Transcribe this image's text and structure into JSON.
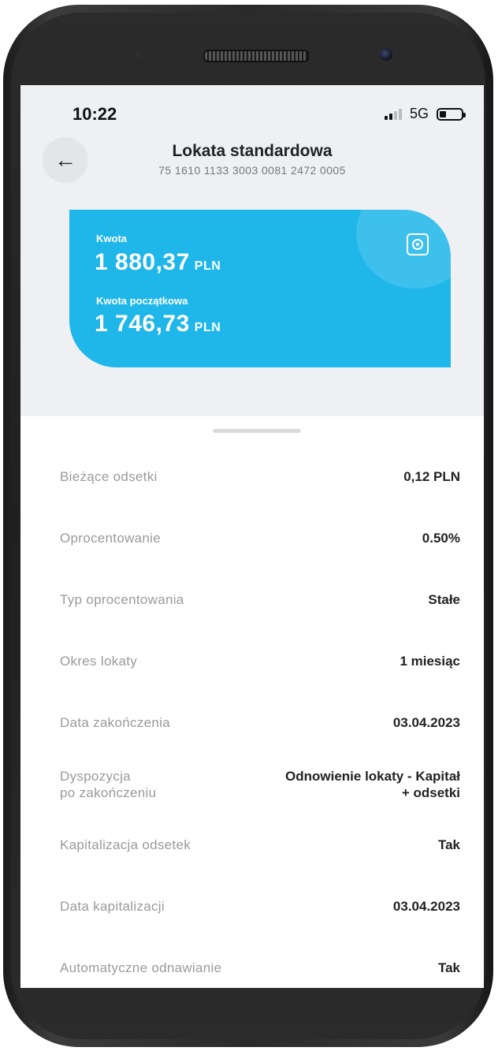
{
  "status_bar": {
    "time": "10:22",
    "network": "5G"
  },
  "header": {
    "title": "Lokata standardowa",
    "account_number": "75 1610 1133 3003 0081 2472 0005",
    "back_icon": "arrow-left-icon",
    "back_glyph": "←"
  },
  "card": {
    "accent_color": "#1fb6e9",
    "icon": "safe-icon",
    "amount_label": "Kwota",
    "amount_value": "1 880,37",
    "amount_currency": "PLN",
    "initial_label": "Kwota początkowa",
    "initial_value": "1 746,73",
    "initial_currency": "PLN"
  },
  "details": [
    {
      "label": "Bieżące odsetki",
      "value": "0,12 PLN"
    },
    {
      "label": "Oprocentowanie",
      "value": "0.50%"
    },
    {
      "label": "Typ oprocentowania",
      "value": "Stałe"
    },
    {
      "label": "Okres lokaty",
      "value": "1 miesiąc"
    },
    {
      "label": "Data zakończenia",
      "value": "03.04.2023"
    },
    {
      "label": "Dyspozycja\npo zakończeniu",
      "value": "Odnowienie lokaty - Kapitał\n+ odsetki"
    },
    {
      "label": "Kapitalizacja odsetek",
      "value": "Tak"
    },
    {
      "label": "Data kapitalizacji",
      "value": "03.04.2023"
    },
    {
      "label": "Automatyczne odnawianie",
      "value": "Tak"
    }
  ]
}
